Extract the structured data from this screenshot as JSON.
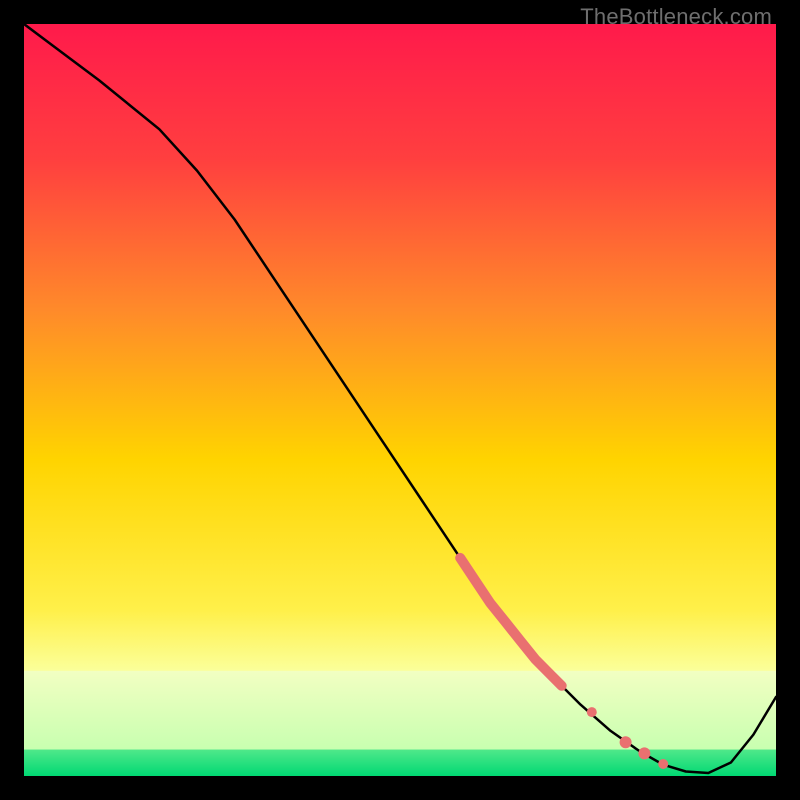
{
  "watermark": "TheBottleneck.com",
  "colors": {
    "curve": "#000000",
    "marker_fill": "#e97070",
    "marker_stroke": "#e97070",
    "gradient_top": "#ff1a4b",
    "gradient_mid1": "#ff7a2a",
    "gradient_mid2": "#ffd400",
    "gradient_mid3": "#fff56b",
    "gradient_band": "#f6ffb0",
    "gradient_bottom": "#00e07a"
  },
  "chart_data": {
    "type": "line",
    "title": "",
    "xlabel": "",
    "ylabel": "",
    "xlim": [
      0,
      100
    ],
    "ylim": [
      0,
      100
    ],
    "grid": false,
    "legend": false,
    "series": [
      {
        "name": "bottleneck-curve",
        "x": [
          0,
          4,
          10,
          18,
          23,
          28,
          33,
          38,
          43,
          48,
          53,
          58,
          62,
          66,
          70,
          74,
          78,
          82,
          85,
          88,
          91,
          94,
          97,
          100
        ],
        "y": [
          100,
          97,
          92.5,
          86,
          80.5,
          74,
          66.5,
          59,
          51.5,
          44,
          36.5,
          29,
          23,
          18,
          13.5,
          9.5,
          6,
          3.2,
          1.5,
          0.6,
          0.4,
          1.8,
          5.5,
          10.5
        ]
      }
    ],
    "markers": [
      {
        "name": "highlight-segment-thick",
        "kind": "polyline",
        "stroke_width": 10,
        "x": [
          58,
          60,
          62,
          64,
          66,
          68,
          70,
          71.5
        ],
        "y": [
          29,
          26,
          23,
          20.5,
          18,
          15.5,
          13.5,
          12
        ]
      },
      {
        "name": "highlight-dot-1",
        "kind": "dot",
        "r": 5,
        "x": 75.5,
        "y": 8.5
      },
      {
        "name": "highlight-dot-2",
        "kind": "dot",
        "r": 6,
        "x": 80,
        "y": 4.5
      },
      {
        "name": "highlight-dot-3",
        "kind": "dot",
        "r": 6,
        "x": 82.5,
        "y": 3
      },
      {
        "name": "highlight-dot-4",
        "kind": "dot",
        "r": 5,
        "x": 85,
        "y": 1.6
      }
    ],
    "background_bands": [
      {
        "from_y": 0,
        "to_y": 3,
        "color_key": "gradient_bottom"
      },
      {
        "from_y": 3,
        "to_y": 14,
        "color_key": "gradient_band"
      },
      {
        "from_y": 14,
        "to_y": 100,
        "color_key": "gradient_top_to_yellow"
      }
    ]
  }
}
